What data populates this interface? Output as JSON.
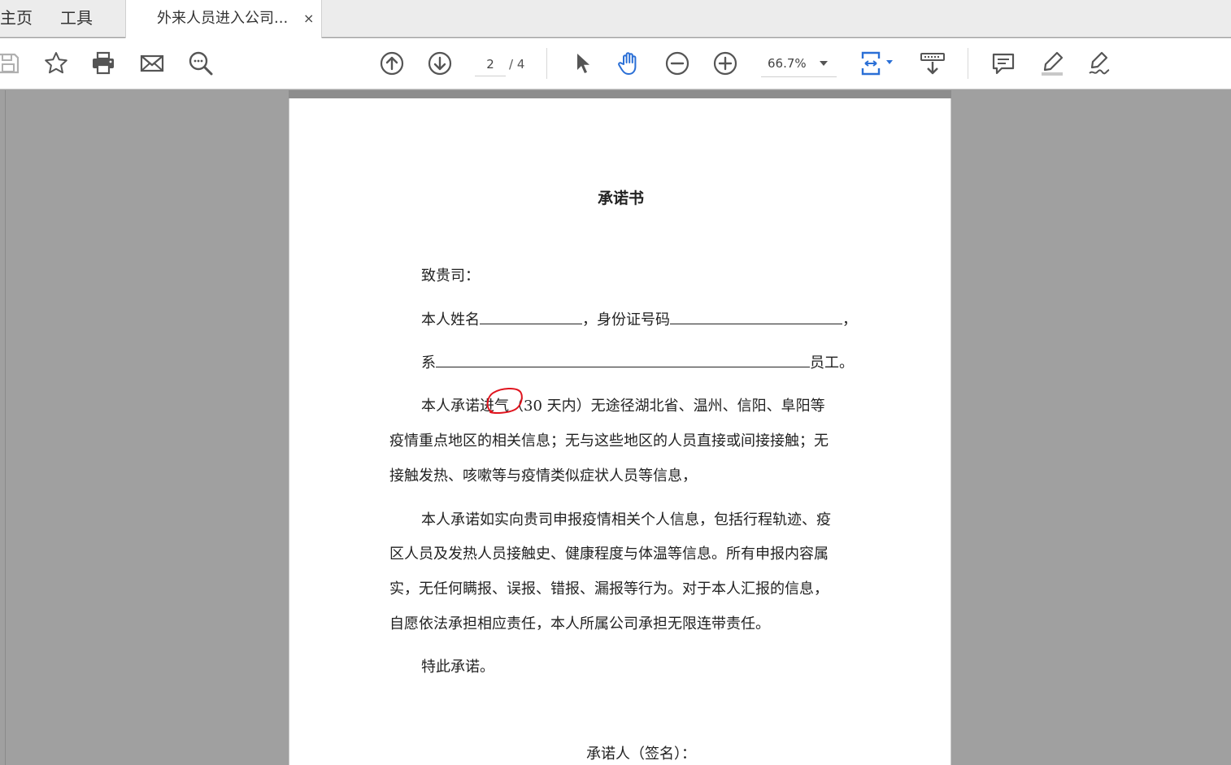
{
  "tabs": {
    "home": "主页",
    "tools": "工具",
    "document_title": "外来人员进入公司...",
    "close_glyph": "×"
  },
  "toolbar": {
    "icons": [
      "save-icon",
      "bookmark-star-icon",
      "print-icon",
      "email-icon",
      "search-icon",
      "page-up-icon",
      "page-down-icon",
      "select-cursor-icon",
      "hand-tool-icon",
      "zoom-out-icon",
      "zoom-in-icon",
      "fit-page-icon",
      "scroll-mode-icon",
      "comment-icon",
      "highlight-pen-icon",
      "sign-icon"
    ],
    "page_current": "2",
    "page_total": "/ 4",
    "zoom": "66.7%"
  },
  "document": {
    "title": "承诺书",
    "greeting": "致贵司：",
    "name_label": "本人姓名",
    "id_label": "，身份证号码",
    "line_end_comma": "，",
    "affiliation_prefix": "系",
    "affiliation_suffix": "员工。",
    "p1_line1": "本人承诺进气（30 天内）无途径湖北省、温州、信阳、阜阳等",
    "p1_line2": "疫情重点地区的相关信息；无与这些地区的人员直接或间接接触；无",
    "p1_line3": "接触发热、咳嗽等与疫情类似症状人员等信息，",
    "p2_line1": "本人承诺如实向贵司申报疫情相关个人信息，包括行程轨迹、疫",
    "p2_line2": "区人员及发热人员接触史、健康程度与体温等信息。所有申报内容属",
    "p2_line3": "实，无任何瞒报、误报、错报、漏报等行为。对于本人汇报的信息，",
    "p2_line4": "自愿依法承担相应责任，本人所属公司承担无限连带责任。",
    "closing": "特此承诺。",
    "signature_label": "承诺人（签名）："
  },
  "colors": {
    "annotation": "#e0141e",
    "accent_blue": "#2a6fd6"
  }
}
